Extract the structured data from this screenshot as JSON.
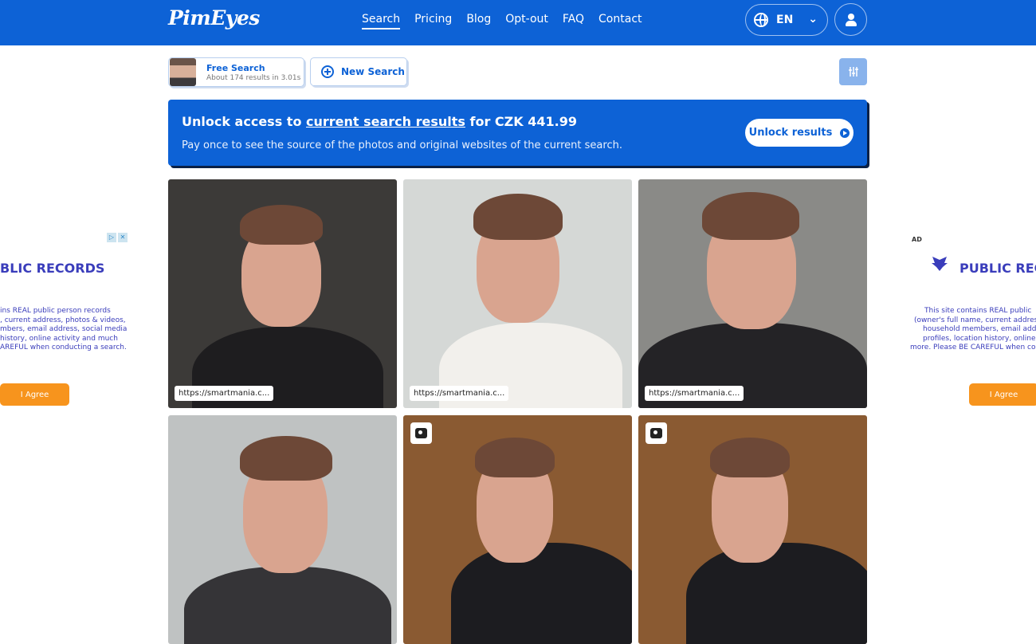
{
  "header": {
    "logo": "PimEyes",
    "nav": [
      "Search",
      "Pricing",
      "Blog",
      "Opt-out",
      "FAQ",
      "Contact"
    ],
    "active_nav": "Search",
    "language": "EN"
  },
  "toolbar": {
    "free_search_title": "Free Search",
    "free_search_subtitle": "About 174 results in 3.01s",
    "new_search_label": "New Search"
  },
  "banner": {
    "heading_pre": "Unlock access to ",
    "heading_link": "current search results",
    "heading_post": " for CZK 441.99",
    "subtext": "Pay once to see the source of the photos and original websites of the current search.",
    "button_label": "Unlock results"
  },
  "results": [
    {
      "url": "https://smartmania.c...",
      "badge": false,
      "bg": "#3c3a38",
      "shirt": "#1e1d1f"
    },
    {
      "url": "https://smartmania.c...",
      "badge": false,
      "bg": "#d5d8d6",
      "shirt": "#f2f0ec"
    },
    {
      "url": "https://smartmania.c...",
      "badge": false,
      "bg": "#8a8a87",
      "shirt": "#242326"
    },
    {
      "url": "",
      "badge": false,
      "bg": "#bfc2c2",
      "shirt": "#353437"
    },
    {
      "url": "",
      "badge": true,
      "bg": "#8a5a32",
      "shirt": "#1c1c20"
    },
    {
      "url": "",
      "badge": true,
      "bg": "#8a5a32",
      "shirt": "#1c1c20"
    }
  ],
  "ads": {
    "left_title": "BLIC RECORDS",
    "left_body": [
      "ins REAL public person records",
      ", current address, photos & videos,",
      "mbers, email address, social media",
      "history, online activity and much",
      "AREFUL when conducting a search."
    ],
    "left_button": "I Agree",
    "right_label": "AD",
    "right_title": "PUBLIC REC",
    "right_body": [
      "This site contains REAL public",
      "(owner's full name, current addres",
      "household members, email addr",
      "profiles, location history, online a",
      "more. Please BE CAREFUL when co"
    ],
    "right_button": "I Agree"
  },
  "colors": {
    "brand": "#0d62d6",
    "ad_text": "#3a3dbb",
    "agree": "#f7941d"
  }
}
